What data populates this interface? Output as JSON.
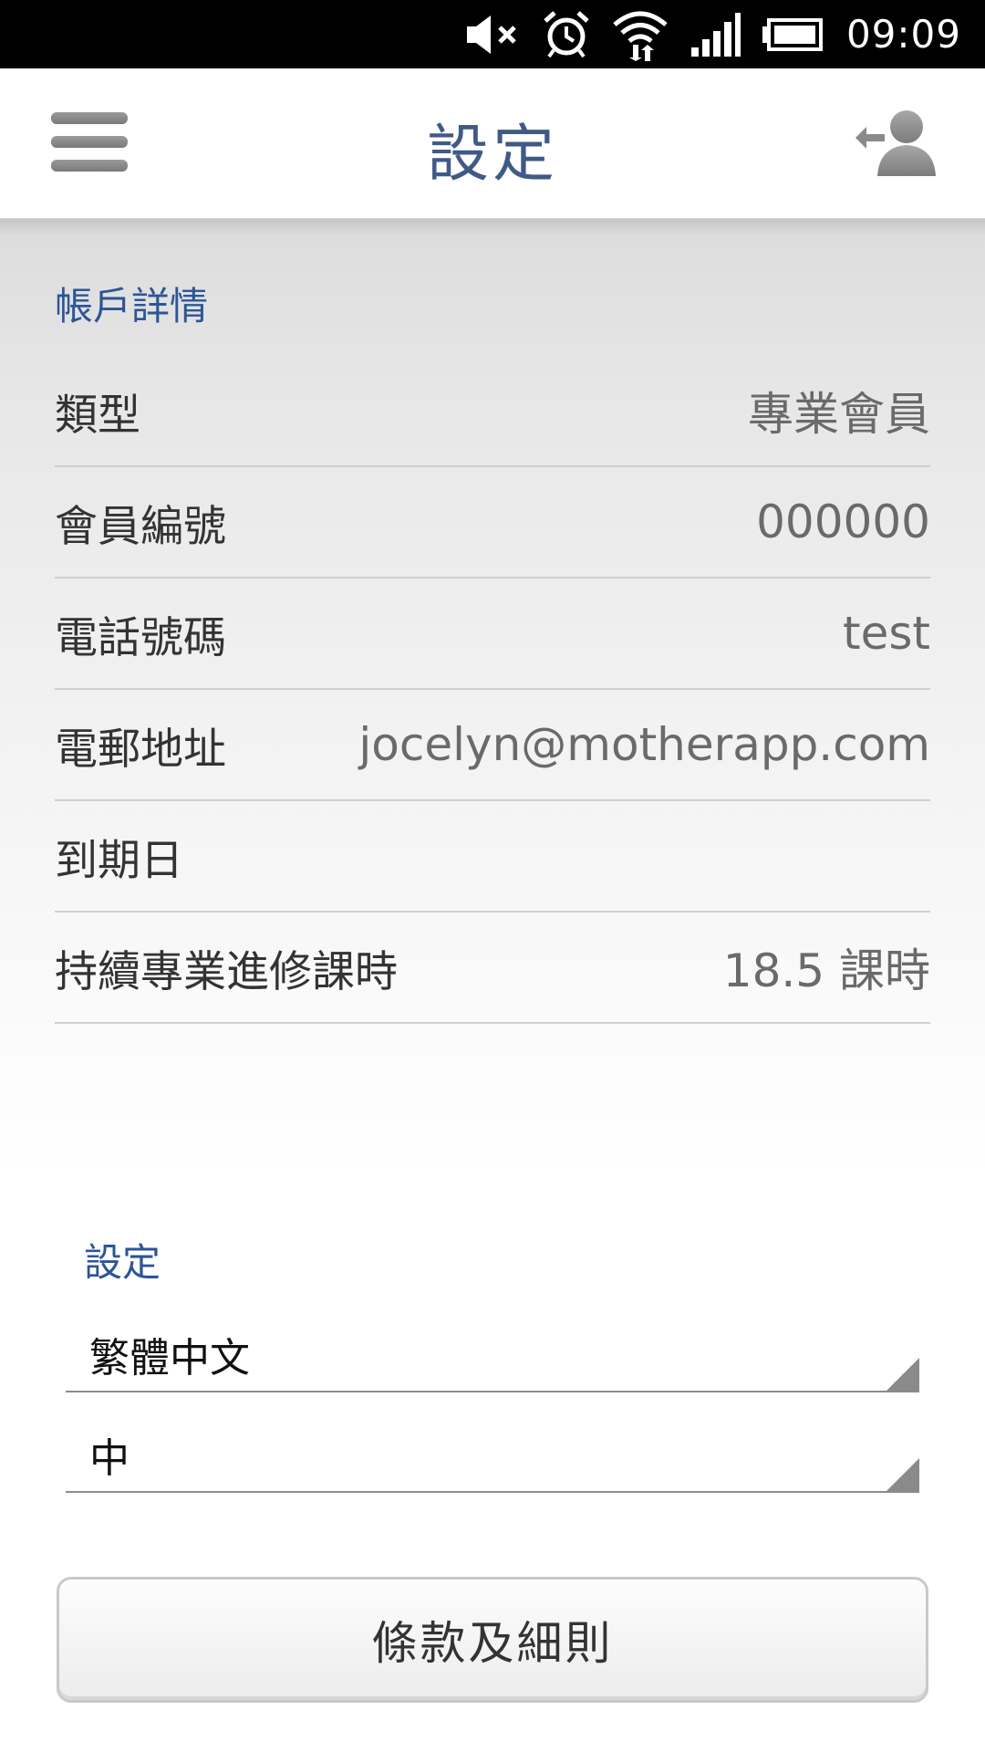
{
  "status_bar": {
    "time": "09:09",
    "icons": [
      "mute-icon",
      "alarm-icon",
      "wifi-icon",
      "signal-icon",
      "battery-icon"
    ]
  },
  "app_bar": {
    "title": "設定",
    "menu_icon": "hamburger-menu-icon",
    "logout_icon": "logout-user-icon",
    "title_color": "#3f5a86"
  },
  "account": {
    "section_title": "帳戶詳情",
    "rows": [
      {
        "label": "類型",
        "value": "專業會員"
      },
      {
        "label": "會員編號",
        "value": "000000"
      },
      {
        "label": "電話號碼",
        "value": "test"
      },
      {
        "label": "電郵地址",
        "value": "jocelyn@motherapp.com"
      },
      {
        "label": "到期日",
        "value": ""
      },
      {
        "label": "持續專業進修課時",
        "value": "18.5 課時"
      }
    ]
  },
  "settings": {
    "section_title": "設定",
    "language_select": "繁體中文",
    "font_size_select": "中"
  },
  "terms_button": "條款及細則",
  "colors": {
    "accent": "#2d5597",
    "status_bar": "#000000"
  }
}
